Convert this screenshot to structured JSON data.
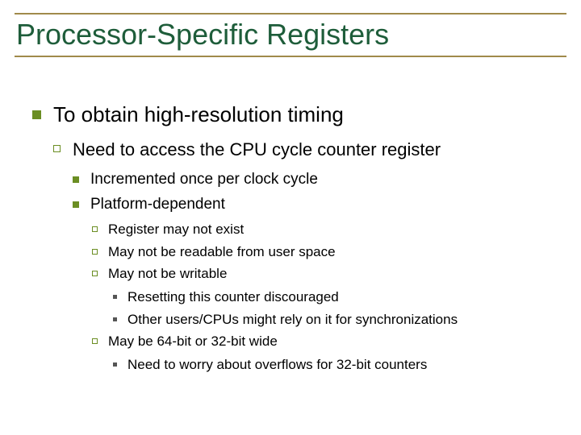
{
  "title": "Processor-Specific Registers",
  "l1": {
    "t": "To obtain high-resolution timing",
    "l2": {
      "t": "Need to access the CPU cycle counter register",
      "l3a": "Incremented once per clock cycle",
      "l3b": {
        "t": "Platform-dependent",
        "l4a": "Register may not exist",
        "l4b": "May not be readable from user space",
        "l4c": {
          "t": "May not be writable",
          "l5a": "Resetting this counter discouraged",
          "l5b": "Other users/CPUs might rely on it for synchronizations"
        },
        "l4d": {
          "t": "May be 64-bit or 32-bit wide",
          "l5a": "Need to worry about overflows for 32-bit counters"
        }
      }
    }
  }
}
